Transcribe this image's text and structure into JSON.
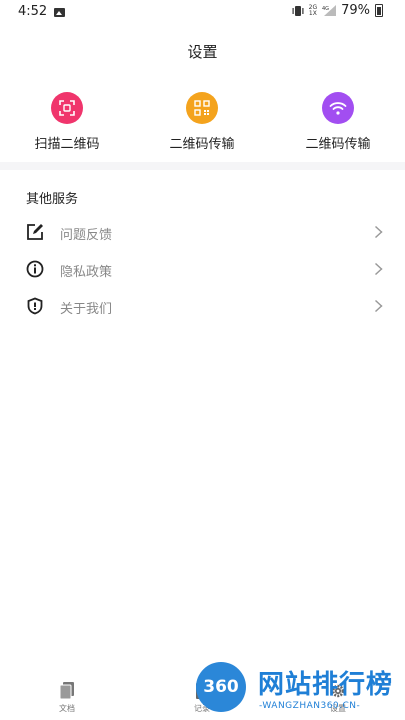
{
  "status_bar": {
    "time": "4:52",
    "net_top": "2G",
    "net_bottom": "1X",
    "net_signal_label": "4G",
    "battery": "79%"
  },
  "header": {
    "title": "设置"
  },
  "actions": [
    {
      "label": "扫描二维码",
      "color": "#f0356c",
      "icon": "scan-icon"
    },
    {
      "label": "二维码传输",
      "color": "#f4a31d",
      "icon": "qr-code-icon"
    },
    {
      "label": "二维码传输",
      "color": "#a24ef1",
      "icon": "wifi-icon"
    }
  ],
  "services": {
    "title": "其他服务",
    "items": [
      {
        "label": "问题反馈",
        "icon": "edit-icon"
      },
      {
        "label": "隐私政策",
        "icon": "info-icon"
      },
      {
        "label": "关于我们",
        "icon": "shield-icon"
      }
    ]
  },
  "bottom_nav": {
    "items": [
      {
        "label": "文档",
        "icon": "document-icon"
      },
      {
        "label": "记录",
        "icon": "record-icon"
      },
      {
        "label": "设置",
        "icon": "gear-icon"
      }
    ]
  },
  "watermark": {
    "logo_text": "360",
    "title": "网站排行榜",
    "subtitle": "-WANGZHAN360.CN-"
  }
}
